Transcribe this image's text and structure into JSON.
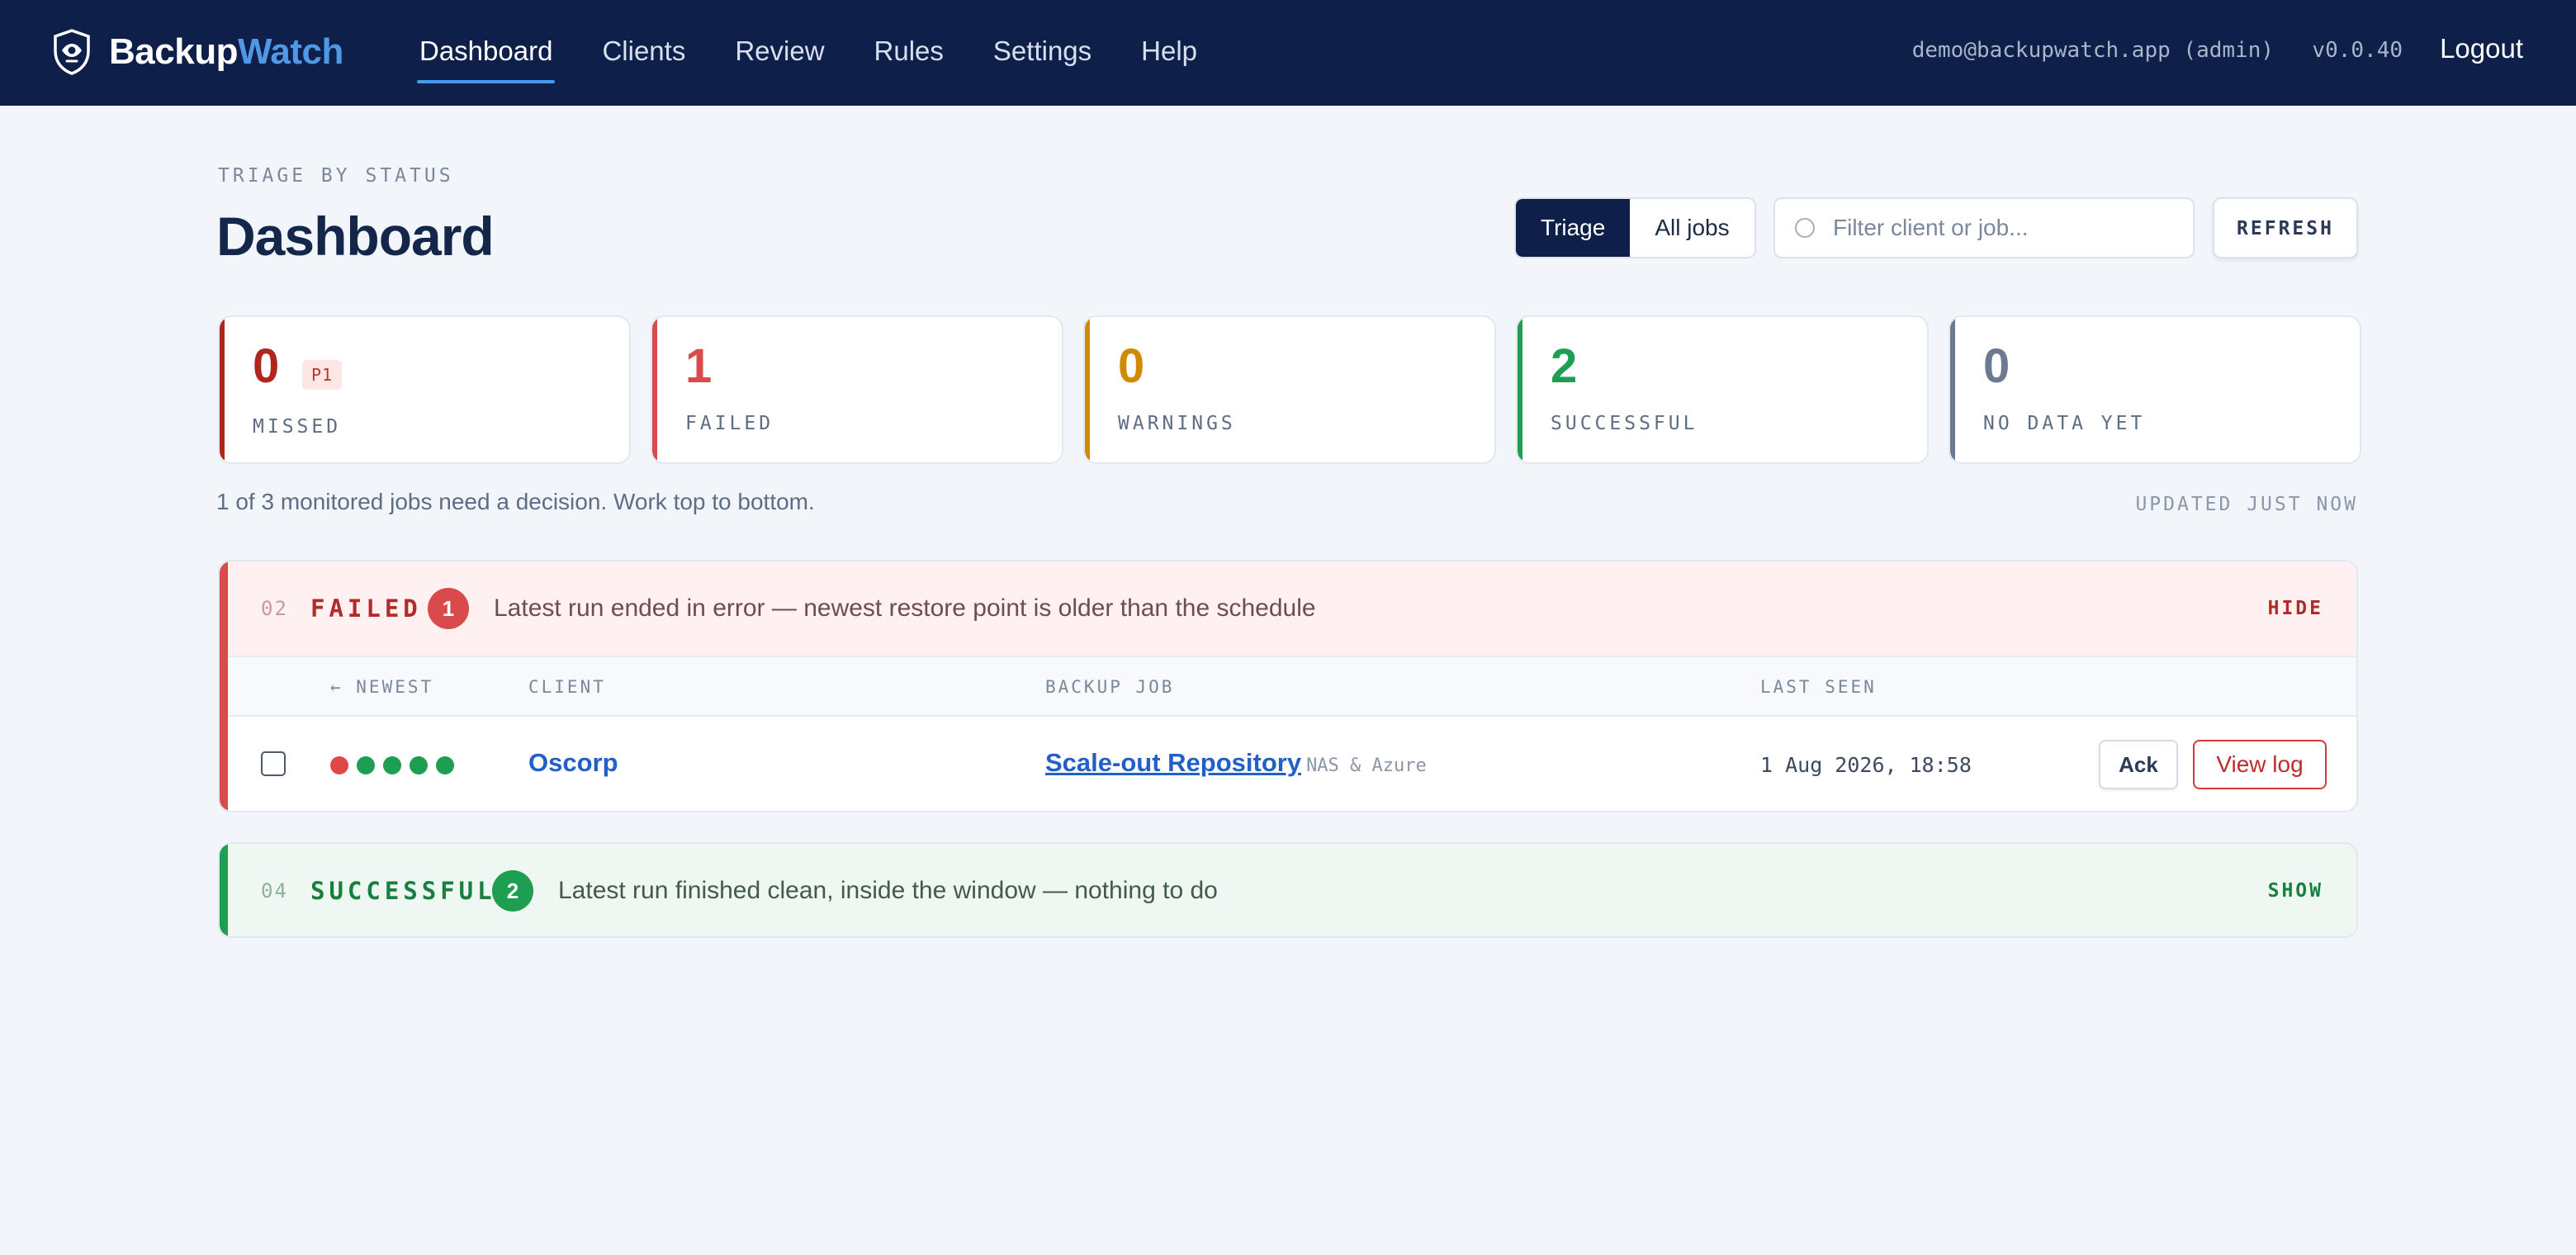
{
  "brand": {
    "name_part1": "Backup",
    "name_part2": "Watch",
    "logo_icon": "shield-eye-icon"
  },
  "nav": {
    "items": [
      {
        "label": "Dashboard",
        "active": true
      },
      {
        "label": "Clients",
        "active": false
      },
      {
        "label": "Review",
        "active": false
      },
      {
        "label": "Rules",
        "active": false
      },
      {
        "label": "Settings",
        "active": false
      },
      {
        "label": "Help",
        "active": false
      }
    ],
    "user": "demo@backupwatch.app (admin)",
    "version": "v0.0.40",
    "logout_label": "Logout"
  },
  "header": {
    "eyebrow": "TRIAGE BY STATUS",
    "title": "Dashboard",
    "view_toggle": {
      "triage": "Triage",
      "all_jobs": "All jobs",
      "selected": "Triage"
    },
    "filter_placeholder": "Filter client or job...",
    "refresh_label": "REFRESH"
  },
  "stats": [
    {
      "value": "0",
      "label": "MISSED",
      "badge": "P1",
      "color": "#b0261e"
    },
    {
      "value": "1",
      "label": "FAILED",
      "color": "#d94a4a"
    },
    {
      "value": "0",
      "label": "WARNINGS",
      "color": "#cf8a06"
    },
    {
      "value": "2",
      "label": "SUCCESSFUL",
      "color": "#1e9e50"
    },
    {
      "value": "0",
      "label": "NO DATA YET",
      "color": "#6b7a90"
    }
  ],
  "summary": "1 of 3 monitored jobs need a decision. Work top to bottom.",
  "updated": "UPDATED JUST NOW",
  "groups": {
    "failed": {
      "num": "02",
      "title": "FAILED",
      "count": "1",
      "description": "Latest run ended in error — newest restore point is older than the schedule",
      "toggle": "HIDE",
      "columns": {
        "newest": "← NEWEST",
        "client": "CLIENT",
        "job": "BACKUP JOB",
        "last_seen": "LAST SEEN"
      },
      "rows": [
        {
          "history": [
            "failed",
            "success",
            "success",
            "success",
            "success"
          ],
          "client": "Oscorp",
          "job": "Scale-out Repository",
          "job_sub": "NAS & Azure",
          "last_seen": "1 Aug 2026, 18:58",
          "ack_label": "Ack",
          "view_log_label": "View log"
        }
      ]
    },
    "successful": {
      "num": "04",
      "title": "SUCCESSFUL",
      "count": "2",
      "description": "Latest run finished clean, inside the window — nothing to do",
      "toggle": "SHOW"
    }
  },
  "status_colors": {
    "failed": "#e04848",
    "success": "#1e9e50"
  }
}
